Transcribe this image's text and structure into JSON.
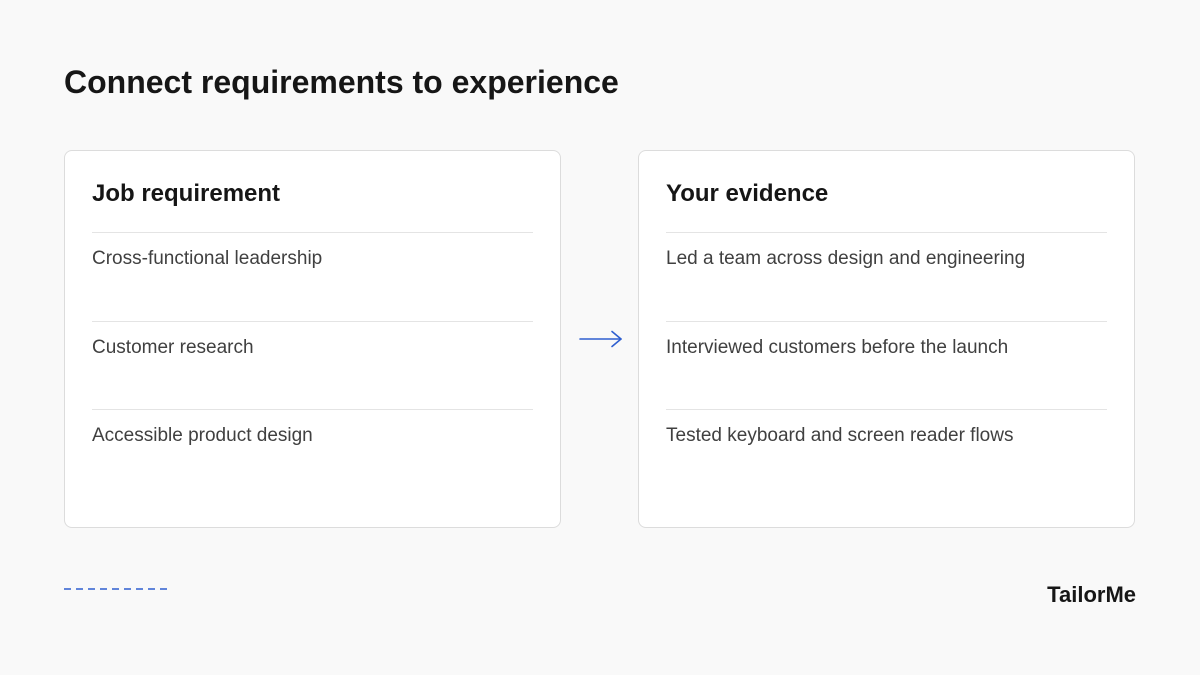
{
  "page": {
    "title": "Connect requirements to experience",
    "accent_color": "#2f5fd0"
  },
  "left_card": {
    "heading": "Job requirement",
    "items": [
      "Cross-functional leadership",
      "Customer research",
      "Accessible product design"
    ]
  },
  "right_card": {
    "heading": "Your evidence",
    "items": [
      "Led a team across design and engineering",
      "Interviewed customers before the launch",
      "Tested keyboard and screen reader flows"
    ]
  },
  "connector": {
    "icon": "arrow-right-icon"
  },
  "footer": {
    "decoration_icon": "dashed-line-icon",
    "brand": "TailorMe"
  }
}
